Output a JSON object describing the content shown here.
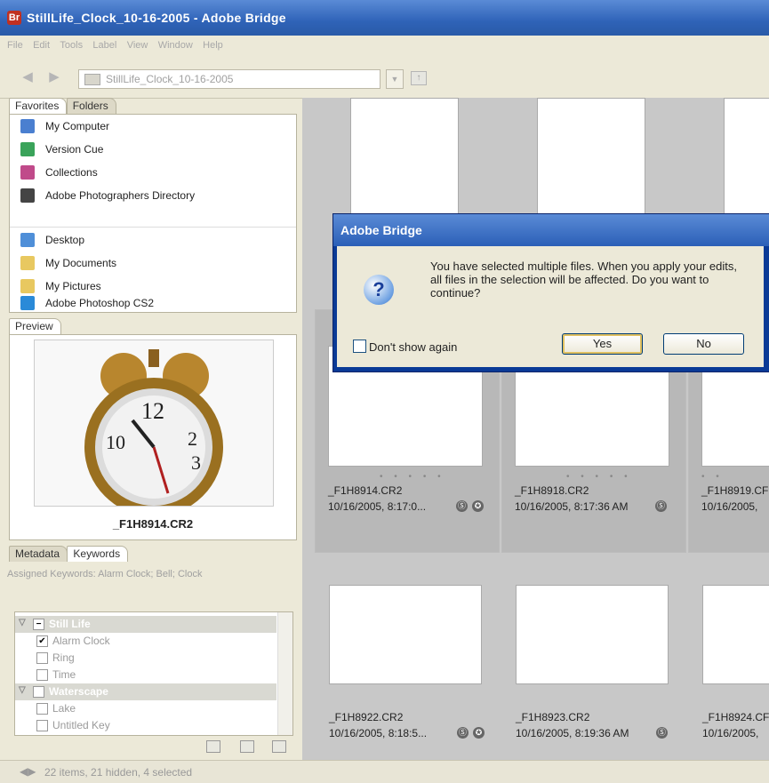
{
  "window": {
    "title": "StillLife_Clock_10-16-2005 - Adobe Bridge",
    "app_icon": "Br"
  },
  "menu": [
    "File",
    "Edit",
    "Tools",
    "Label",
    "View",
    "Window",
    "Help"
  ],
  "toolbar": {
    "back": "◀",
    "forward": "▶",
    "path": "StillLife_Clock_10-16-2005",
    "dropdown": "▼",
    "up": "↑"
  },
  "favorites_tabs": [
    "Favorites",
    "Folders"
  ],
  "favorites": [
    {
      "label": "My Computer",
      "icon": "computer-icon",
      "color": "#4a7fd0"
    },
    {
      "label": "Version Cue",
      "icon": "version-cue-icon",
      "color": "#3aa35a"
    },
    {
      "label": "Collections",
      "icon": "collections-icon",
      "color": "#c04a8a"
    },
    {
      "label": "Adobe Photographers Directory",
      "icon": "camera-tripod-icon",
      "color": "#444444"
    },
    {
      "label": "Desktop",
      "icon": "desktop-icon",
      "color": "#4f8fd8"
    },
    {
      "label": "My Documents",
      "icon": "folder-icon",
      "color": "#e8c860"
    },
    {
      "label": "My Pictures",
      "icon": "folder-pictures-icon",
      "color": "#e8c860"
    },
    {
      "label": "Adobe Photoshop CS2",
      "icon": "photoshop-feather-icon",
      "color": "#2a8ad8"
    }
  ],
  "preview": {
    "tab": "Preview",
    "caption": "_F1H8914.CR2"
  },
  "meta_tabs": [
    "Metadata",
    "Keywords"
  ],
  "assigned_keywords": "Assigned Keywords: Alarm Clock; Bell; Clock",
  "keywords": [
    {
      "label": "Still Life",
      "type": "category",
      "state": "−"
    },
    {
      "label": "Alarm Clock",
      "type": "item",
      "state": "✔"
    },
    {
      "label": "Ring",
      "type": "item",
      "state": ""
    },
    {
      "label": "Time",
      "type": "item",
      "state": ""
    },
    {
      "label": "Waterscape",
      "type": "category",
      "state": ""
    },
    {
      "label": "Lake",
      "type": "item",
      "state": ""
    },
    {
      "label": "Untitled Key",
      "type": "item",
      "state": ""
    }
  ],
  "thumbnails": [
    {
      "name": "_F1H8914.CR2",
      "date": "10/16/2005, 8:17:0...",
      "stars": "• • • • •",
      "icons": [
        "Ⓢ",
        "✪"
      ]
    },
    {
      "name": "_F1H8918.CR2",
      "date": "10/16/2005, 8:17:36 AM",
      "stars": "• • • • •",
      "icons": [
        "Ⓢ"
      ]
    },
    {
      "name": "_F1H8919.CF",
      "date": "10/16/2005,",
      "stars": "• •",
      "icons": []
    },
    {
      "name": "_F1H8922.CR2",
      "date": "10/16/2005, 8:18:5...",
      "stars": "",
      "icons": [
        "Ⓢ",
        "✪"
      ]
    },
    {
      "name": "_F1H8923.CR2",
      "date": "10/16/2005, 8:19:36 AM",
      "stars": "",
      "icons": [
        "Ⓢ"
      ]
    },
    {
      "name": "_F1H8924.CF",
      "date": "10/16/2005,",
      "stars": "",
      "icons": []
    }
  ],
  "dialog": {
    "title": "Adobe Bridge",
    "message": "You have selected multiple files.  When you apply your edits, all files in the selection will be affected. Do you want to continue?",
    "checkbox_label": "Don't show again",
    "yes": "Yes",
    "no": "No"
  },
  "status": {
    "text": "22 items, 21 hidden, 4 selected",
    "arrows": "◀▶"
  }
}
